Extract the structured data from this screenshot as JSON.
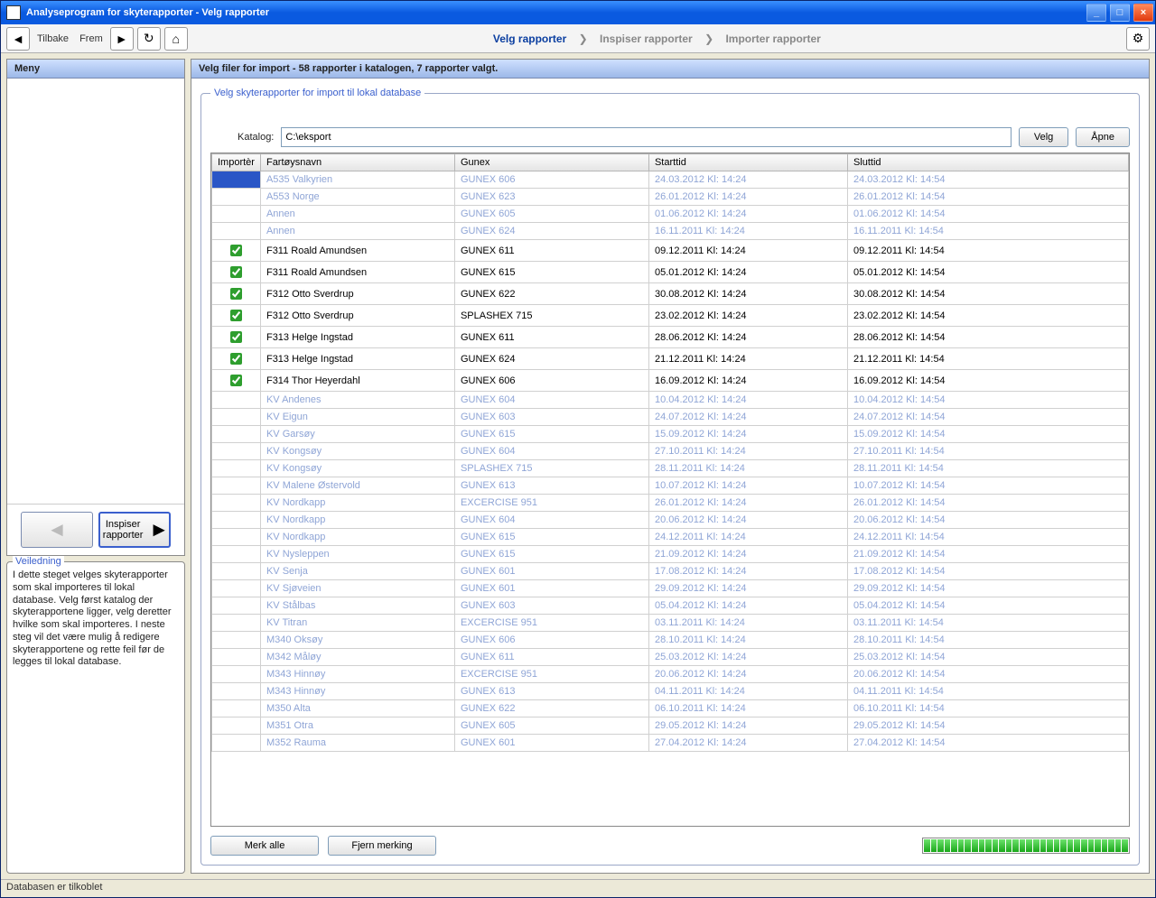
{
  "window": {
    "title": "Analyseprogram for skyterapporter - Velg rapporter"
  },
  "toolbar": {
    "back": "Tilbake",
    "forward": "Frem"
  },
  "breadcrumb": {
    "step1": "Velg rapporter",
    "step2": "Inspiser rapporter",
    "step3": "Importer rapporter"
  },
  "sidebar": {
    "menu_title": "Meny",
    "inspiser_label": "Inspiser rapporter",
    "veiledning_title": "Veiledning",
    "veiledning_text": "I dette steget velges skyterapporter som skal importeres til lokal database. Velg først katalog der skyterapportene ligger, velg deretter hvilke som skal importeres. I neste steg vil det være mulig å redigere skyterapportene og rette feil før de legges til lokal database."
  },
  "main": {
    "header": "Velg filer for import - 58 rapporter i katalogen, 7 rapporter valgt.",
    "group_title": "Velg skyterapporter for import til lokal database",
    "catalog_label": "Katalog:",
    "catalog_value": "C:\\eksport",
    "btn_velg": "Velg",
    "btn_apne": "Åpne",
    "btn_merk_alle": "Merk alle",
    "btn_fjern": "Fjern merking",
    "columns": {
      "importer": "Importèr",
      "fartoy": "Fartøysnavn",
      "gunex": "Gunex",
      "start": "Starttid",
      "slutt": "Sluttid"
    },
    "rows": [
      {
        "sel": true,
        "chk": false,
        "dim": true,
        "fartoy": "A535 Valkyrien",
        "gunex": "GUNEX 606",
        "start": "24.03.2012 Kl: 14:24",
        "slutt": "24.03.2012 Kl: 14:54"
      },
      {
        "chk": false,
        "dim": true,
        "fartoy": "A553 Norge",
        "gunex": "GUNEX 623",
        "start": "26.01.2012 Kl: 14:24",
        "slutt": "26.01.2012 Kl: 14:54"
      },
      {
        "chk": false,
        "dim": true,
        "fartoy": "Annen",
        "gunex": "GUNEX 605",
        "start": "01.06.2012 Kl: 14:24",
        "slutt": "01.06.2012 Kl: 14:54"
      },
      {
        "chk": false,
        "dim": true,
        "fartoy": "Annen",
        "gunex": "GUNEX 624",
        "start": "16.11.2011 Kl: 14:24",
        "slutt": "16.11.2011 Kl: 14:54"
      },
      {
        "chk": true,
        "dim": false,
        "fartoy": "F311 Roald Amundsen",
        "gunex": "GUNEX 611",
        "start": "09.12.2011 Kl: 14:24",
        "slutt": "09.12.2011 Kl: 14:54"
      },
      {
        "chk": true,
        "dim": false,
        "fartoy": "F311 Roald Amundsen",
        "gunex": "GUNEX 615",
        "start": "05.01.2012 Kl: 14:24",
        "slutt": "05.01.2012 Kl: 14:54"
      },
      {
        "chk": true,
        "dim": false,
        "fartoy": "F312 Otto Sverdrup",
        "gunex": "GUNEX 622",
        "start": "30.08.2012 Kl: 14:24",
        "slutt": "30.08.2012 Kl: 14:54"
      },
      {
        "chk": true,
        "dim": false,
        "fartoy": "F312 Otto Sverdrup",
        "gunex": "SPLASHEX 715",
        "start": "23.02.2012 Kl: 14:24",
        "slutt": "23.02.2012 Kl: 14:54"
      },
      {
        "chk": true,
        "dim": false,
        "fartoy": "F313 Helge Ingstad",
        "gunex": "GUNEX 611",
        "start": "28.06.2012 Kl: 14:24",
        "slutt": "28.06.2012 Kl: 14:54"
      },
      {
        "chk": true,
        "dim": false,
        "fartoy": "F313 Helge Ingstad",
        "gunex": "GUNEX 624",
        "start": "21.12.2011 Kl: 14:24",
        "slutt": "21.12.2011 Kl: 14:54"
      },
      {
        "chk": true,
        "dim": false,
        "fartoy": "F314 Thor Heyerdahl",
        "gunex": "GUNEX 606",
        "start": "16.09.2012 Kl: 14:24",
        "slutt": "16.09.2012 Kl: 14:54"
      },
      {
        "chk": false,
        "dim": true,
        "fartoy": "KV Andenes",
        "gunex": "GUNEX 604",
        "start": "10.04.2012 Kl: 14:24",
        "slutt": "10.04.2012 Kl: 14:54"
      },
      {
        "chk": false,
        "dim": true,
        "fartoy": "KV Eigun",
        "gunex": "GUNEX 603",
        "start": "24.07.2012 Kl: 14:24",
        "slutt": "24.07.2012 Kl: 14:54"
      },
      {
        "chk": false,
        "dim": true,
        "fartoy": "KV Garsøy",
        "gunex": "GUNEX 615",
        "start": "15.09.2012 Kl: 14:24",
        "slutt": "15.09.2012 Kl: 14:54"
      },
      {
        "chk": false,
        "dim": true,
        "fartoy": "KV Kongsøy",
        "gunex": "GUNEX 604",
        "start": "27.10.2011 Kl: 14:24",
        "slutt": "27.10.2011 Kl: 14:54"
      },
      {
        "chk": false,
        "dim": true,
        "fartoy": "KV Kongsøy",
        "gunex": "SPLASHEX 715",
        "start": "28.11.2011 Kl: 14:24",
        "slutt": "28.11.2011 Kl: 14:54"
      },
      {
        "chk": false,
        "dim": true,
        "fartoy": "KV Malene Østervold",
        "gunex": "GUNEX 613",
        "start": "10.07.2012 Kl: 14:24",
        "slutt": "10.07.2012 Kl: 14:54"
      },
      {
        "chk": false,
        "dim": true,
        "fartoy": "KV Nordkapp",
        "gunex": "EXCERCISE 951",
        "start": "26.01.2012 Kl: 14:24",
        "slutt": "26.01.2012 Kl: 14:54"
      },
      {
        "chk": false,
        "dim": true,
        "fartoy": "KV Nordkapp",
        "gunex": "GUNEX 604",
        "start": "20.06.2012 Kl: 14:24",
        "slutt": "20.06.2012 Kl: 14:54"
      },
      {
        "chk": false,
        "dim": true,
        "fartoy": "KV Nordkapp",
        "gunex": "GUNEX 615",
        "start": "24.12.2011 Kl: 14:24",
        "slutt": "24.12.2011 Kl: 14:54"
      },
      {
        "chk": false,
        "dim": true,
        "fartoy": "KV Nysleppen",
        "gunex": "GUNEX 615",
        "start": "21.09.2012 Kl: 14:24",
        "slutt": "21.09.2012 Kl: 14:54"
      },
      {
        "chk": false,
        "dim": true,
        "fartoy": "KV Senja",
        "gunex": "GUNEX 601",
        "start": "17.08.2012 Kl: 14:24",
        "slutt": "17.08.2012 Kl: 14:54"
      },
      {
        "chk": false,
        "dim": true,
        "fartoy": "KV Sjøveien",
        "gunex": "GUNEX 601",
        "start": "29.09.2012 Kl: 14:24",
        "slutt": "29.09.2012 Kl: 14:54"
      },
      {
        "chk": false,
        "dim": true,
        "fartoy": "KV Stålbas",
        "gunex": "GUNEX 603",
        "start": "05.04.2012 Kl: 14:24",
        "slutt": "05.04.2012 Kl: 14:54"
      },
      {
        "chk": false,
        "dim": true,
        "fartoy": "KV Titran",
        "gunex": "EXCERCISE 951",
        "start": "03.11.2011 Kl: 14:24",
        "slutt": "03.11.2011 Kl: 14:54"
      },
      {
        "chk": false,
        "dim": true,
        "fartoy": "M340 Oksøy",
        "gunex": "GUNEX 606",
        "start": "28.10.2011 Kl: 14:24",
        "slutt": "28.10.2011 Kl: 14:54"
      },
      {
        "chk": false,
        "dim": true,
        "fartoy": "M342 Måløy",
        "gunex": "GUNEX 611",
        "start": "25.03.2012 Kl: 14:24",
        "slutt": "25.03.2012 Kl: 14:54"
      },
      {
        "chk": false,
        "dim": true,
        "fartoy": "M343 Hinnøy",
        "gunex": "EXCERCISE 951",
        "start": "20.06.2012 Kl: 14:24",
        "slutt": "20.06.2012 Kl: 14:54"
      },
      {
        "chk": false,
        "dim": true,
        "fartoy": "M343 Hinnøy",
        "gunex": "GUNEX 613",
        "start": "04.11.2011 Kl: 14:24",
        "slutt": "04.11.2011 Kl: 14:54"
      },
      {
        "chk": false,
        "dim": true,
        "fartoy": "M350 Alta",
        "gunex": "GUNEX 622",
        "start": "06.10.2011 Kl: 14:24",
        "slutt": "06.10.2011 Kl: 14:54"
      },
      {
        "chk": false,
        "dim": true,
        "fartoy": "M351 Otra",
        "gunex": "GUNEX 605",
        "start": "29.05.2012 Kl: 14:24",
        "slutt": "29.05.2012 Kl: 14:54"
      },
      {
        "chk": false,
        "dim": true,
        "fartoy": "M352 Rauma",
        "gunex": "GUNEX 601",
        "start": "27.04.2012 Kl: 14:24",
        "slutt": "27.04.2012 Kl: 14:54"
      }
    ]
  },
  "status": {
    "text": "Databasen er tilkoblet"
  }
}
